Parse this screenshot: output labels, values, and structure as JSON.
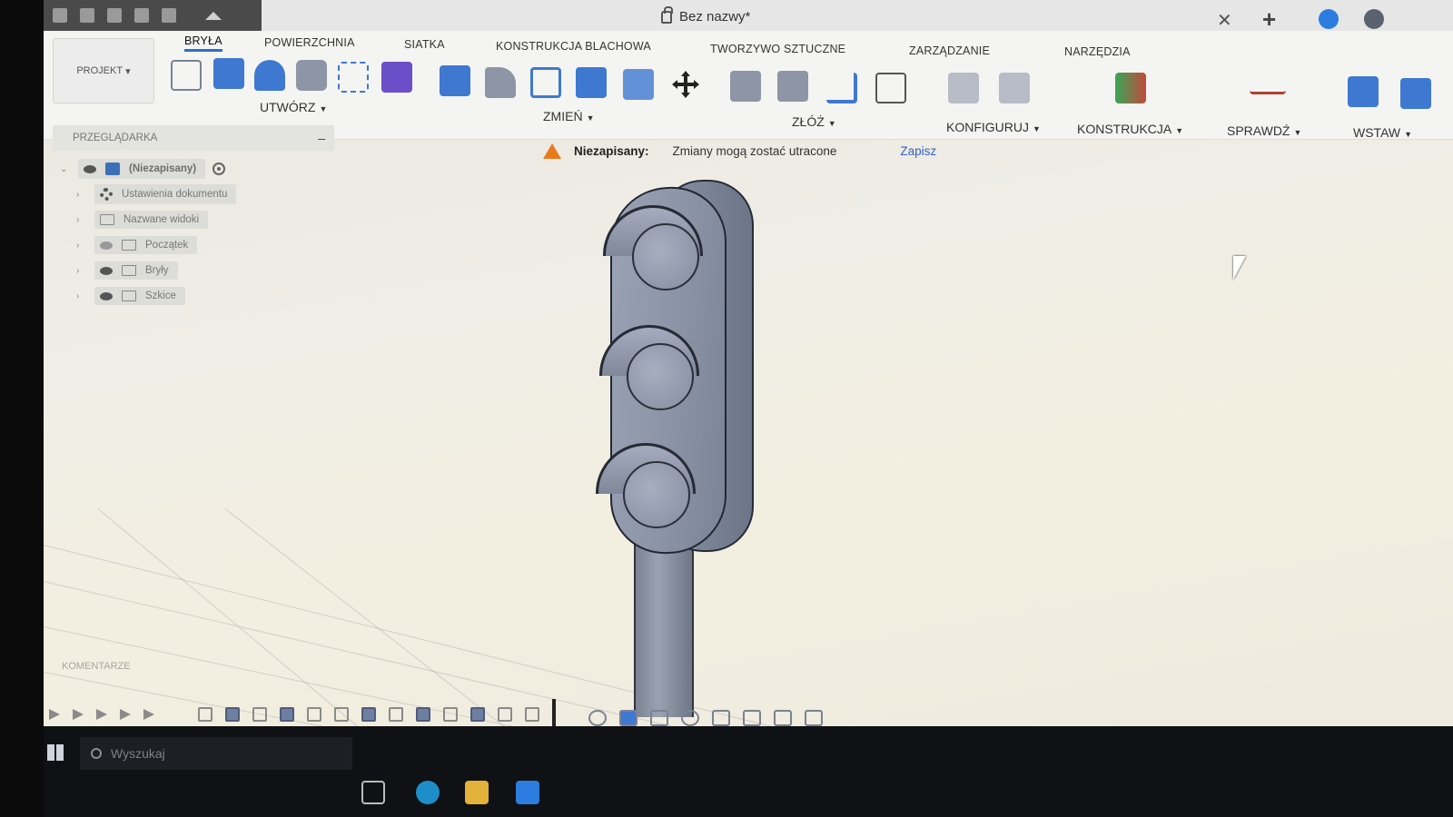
{
  "titlebar": {
    "document_title": "Bez nazwy*"
  },
  "ribbon": {
    "project_button": "PROJEKT",
    "tabs": [
      {
        "label": "BRYŁA",
        "active": true
      },
      {
        "label": "POWIERZCHNIA"
      },
      {
        "label": "SIATKA"
      },
      {
        "label": "KONSTRUKCJA BLACHOWA"
      },
      {
        "label": "TWORZYWO SZTUCZNE"
      },
      {
        "label": "ZARZĄDZANIE"
      },
      {
        "label": "NARZĘDZIA"
      }
    ],
    "groups": {
      "create": "UTWÓRZ",
      "modify": "ZMIEŃ",
      "assemble": "ZŁÓŻ",
      "configure": "KONFIGURUJ",
      "construct": "KONSTRUKCJA",
      "inspect": "SPRAWDŹ",
      "insert": "WSTAW"
    },
    "accent_color": "#2a6ecf"
  },
  "browser": {
    "title": "PRZEGLĄDARKA",
    "root": "(Niezapisany)",
    "items": [
      "Ustawienia dokumentu",
      "Nazwane widoki",
      "Początek",
      "Bryły",
      "Szkice"
    ]
  },
  "banner": {
    "label": "Niezapisany:",
    "message": "Zmiany mogą zostać utracone",
    "save_link": "Zapisz",
    "warning_color": "#e87a1b"
  },
  "comments": {
    "label": "KOMENTARZE"
  },
  "taskbar": {
    "search_placeholder": "Wyszukaj"
  }
}
